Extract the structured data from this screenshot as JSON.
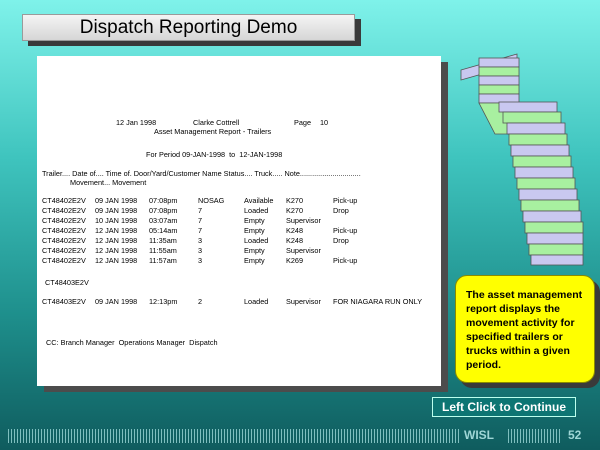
{
  "title": "Dispatch Reporting Demo",
  "report": {
    "header_date": "12 Jan 1998",
    "header_user": "Clarke Cottrell",
    "header_page_label": "Page",
    "header_page_num": "10",
    "report_name": "Asset Management Report - Trailers",
    "period": "For Period 09-JAN-1998  to  12-JAN-1998",
    "columns_line1": "Trailer.... Date of.... Time of. Door/Yard/Customer Name Status.... Truck..... Note..............................",
    "columns_line2": "Movement... Movement",
    "rows": [
      {
        "trailer": "CT48402E2V",
        "date": "09 JAN 1998",
        "time": "07:08pm",
        "door": "NOSAG",
        "status": "Available",
        "truck": "K270",
        "note": "Pick-up"
      },
      {
        "trailer": "CT48402E2V",
        "date": "09 JAN 1998",
        "time": "07:08pm",
        "door": "7",
        "status": "Loaded",
        "truck": "K270",
        "note": "Drop"
      },
      {
        "trailer": "CT48402E2V",
        "date": "10 JAN 1998",
        "time": "03:07am",
        "door": "7",
        "status": "Empty",
        "truck": "Supervisor",
        "note": ""
      },
      {
        "trailer": "CT48402E2V",
        "date": "12 JAN 1998",
        "time": "05:14am",
        "door": "7",
        "status": "Empty",
        "truck": "K248",
        "note": "Pick-up"
      },
      {
        "trailer": "CT48402E2V",
        "date": "12 JAN 1998",
        "time": "11:35am",
        "door": "3",
        "status": "Loaded",
        "truck": "K248",
        "note": "Drop"
      },
      {
        "trailer": "CT48402E2V",
        "date": "12 JAN 1998",
        "time": "11:55am",
        "door": "3",
        "status": "Empty",
        "truck": "Supervisor",
        "note": ""
      },
      {
        "trailer": "CT48402E2V",
        "date": "12 JAN 1998",
        "time": "11:57am",
        "door": "3",
        "status": "Empty",
        "truck": "K269",
        "note": "Pick-up"
      }
    ],
    "group2_label": "CT48403E2V",
    "group2_row": {
      "trailer": "CT48403E2V",
      "date": "09 JAN 1998",
      "time": "12:13pm",
      "door": "2",
      "status": "Loaded",
      "truck": "Supervisor",
      "note": "FOR NIAGARA RUN ONLY"
    },
    "cc_line": "CC: Branch Manager  Operations Manager  Dispatch"
  },
  "callout": {
    "text": "The asset management report displays the movement activity for specified trailers or trucks within a given period."
  },
  "continue_button": {
    "label": "Left Click to Continue"
  },
  "footer": {
    "brand": "WISL",
    "slide_number": "52"
  },
  "colors": {
    "background_top": "#7ff2ea",
    "background_bottom": "#0f5c5e",
    "callout": "#ffff00",
    "button": "#0d7573",
    "paper_green": "#a8f0a0",
    "paper_lavender": "#c9c8f0"
  },
  "icons": {
    "paper_graphic": "continuous-form-paper-icon"
  }
}
